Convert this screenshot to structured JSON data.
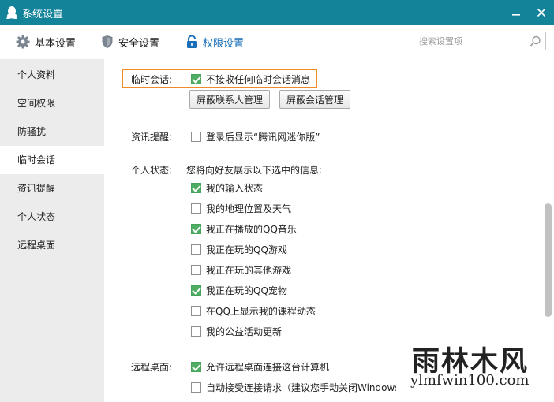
{
  "window": {
    "title": "系统设置",
    "minimize_icon": "minimize-icon",
    "close_icon": "close-icon"
  },
  "toolbar": {
    "tabs": [
      {
        "label": "基本设置",
        "icon": "gear-icon",
        "active": false
      },
      {
        "label": "安全设置",
        "icon": "shield-icon",
        "active": false
      },
      {
        "label": "权限设置",
        "icon": "lock-icon",
        "active": true
      }
    ],
    "search_placeholder": "搜索设置项"
  },
  "sidebar": {
    "items": [
      {
        "label": "个人资料",
        "active": false
      },
      {
        "label": "空间权限",
        "active": false
      },
      {
        "label": "防骚扰",
        "active": false
      },
      {
        "label": "临时会话",
        "active": true
      },
      {
        "label": "资讯提醒",
        "active": false
      },
      {
        "label": "个人状态",
        "active": false
      },
      {
        "label": "远程桌面",
        "active": false
      }
    ]
  },
  "content": {
    "temp_session": {
      "label": "临时会话:",
      "option": {
        "text": "不接收任何临时会话消息",
        "checked": true
      },
      "buttons": [
        "屏蔽联系人管理",
        "屏蔽会话管理"
      ]
    },
    "news": {
      "label": "资讯提醒:",
      "option": {
        "text": "登录后显示“腾讯网迷你版”",
        "checked": false
      }
    },
    "status": {
      "label": "个人状态:",
      "description": "您将向好友展示以下选中的信息:",
      "options": [
        {
          "text": "我的输入状态",
          "checked": true
        },
        {
          "text": "我的地理位置及天气",
          "checked": false
        },
        {
          "text": "我正在播放的QQ音乐",
          "checked": true
        },
        {
          "text": "我正在玩的QQ游戏",
          "checked": false
        },
        {
          "text": "我正在玩的其他游戏",
          "checked": false
        },
        {
          "text": "我正在玩的QQ宠物",
          "checked": true
        },
        {
          "text": "在QQ上显示我的课程动态",
          "checked": false
        },
        {
          "text": "我的公益活动更新",
          "checked": false
        }
      ]
    },
    "remote": {
      "label": "远程桌面:",
      "options": [
        {
          "text": "允许远程桌面连接这台计算机",
          "checked": true
        },
        {
          "text": "自动接受连接请求（建议您手动关闭Windows防火墙）",
          "checked": false
        }
      ]
    }
  },
  "watermark": {
    "big": "雨林木风",
    "small": "ylmfwin100.com"
  },
  "colors": {
    "titlebar": "#13839a",
    "accent": "#1a6fb8",
    "check": "#4fae64",
    "highlight": "#f08a24"
  }
}
